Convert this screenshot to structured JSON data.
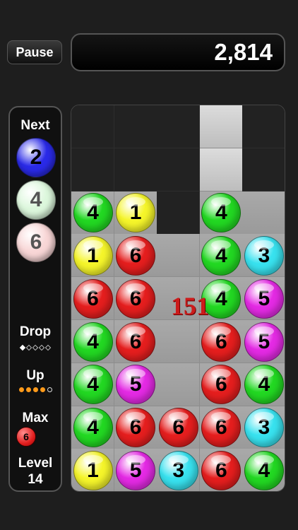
{
  "header": {
    "pause_label": "Pause",
    "score": "2,814"
  },
  "sidebar": {
    "next_label": "Next",
    "next_balls": [
      {
        "value": "2",
        "color": "#2a2ae8",
        "text_color": "#000000"
      },
      {
        "value": "4",
        "color": "#dcf7dc",
        "text_color": "#555555"
      },
      {
        "value": "6",
        "color": "#f8d6d6",
        "text_color": "#555555"
      }
    ],
    "drop_label": "Drop",
    "drop_progress": {
      "filled": 1,
      "total": 5
    },
    "up_label": "Up",
    "up_progress": {
      "filled": 4,
      "total": 5
    },
    "max_label": "Max",
    "max_value": "6",
    "level_label": "Level",
    "level_value": "14"
  },
  "board": {
    "columns": 5,
    "rows": 9,
    "column_heights": [
      7,
      7,
      6,
      9,
      7
    ],
    "cells": [
      [
        null,
        null,
        null,
        null,
        null
      ],
      [
        null,
        null,
        null,
        null,
        null
      ],
      [
        {
          "value": "4",
          "color": "green"
        },
        {
          "value": "1",
          "color": "yellow"
        },
        null,
        {
          "value": "4",
          "color": "green"
        },
        null
      ],
      [
        {
          "value": "1",
          "color": "yellow"
        },
        {
          "value": "6",
          "color": "red"
        },
        null,
        {
          "value": "4",
          "color": "green"
        },
        {
          "value": "3",
          "color": "cyan"
        }
      ],
      [
        {
          "value": "6",
          "color": "red"
        },
        {
          "value": "6",
          "color": "red"
        },
        null,
        {
          "value": "4",
          "color": "green"
        },
        {
          "value": "5",
          "color": "magenta"
        }
      ],
      [
        {
          "value": "4",
          "color": "green"
        },
        {
          "value": "6",
          "color": "red"
        },
        null,
        {
          "value": "6",
          "color": "red"
        },
        {
          "value": "5",
          "color": "magenta"
        }
      ],
      [
        {
          "value": "4",
          "color": "green"
        },
        {
          "value": "5",
          "color": "magenta"
        },
        null,
        {
          "value": "6",
          "color": "red"
        },
        {
          "value": "4",
          "color": "green"
        }
      ],
      [
        {
          "value": "4",
          "color": "green"
        },
        {
          "value": "6",
          "color": "red"
        },
        {
          "value": "6",
          "color": "red"
        },
        {
          "value": "6",
          "color": "red"
        },
        {
          "value": "3",
          "color": "cyan"
        }
      ],
      [
        {
          "value": "1",
          "color": "yellow"
        },
        {
          "value": "5",
          "color": "magenta"
        },
        {
          "value": "3",
          "color": "cyan"
        },
        {
          "value": "6",
          "color": "red"
        },
        {
          "value": "4",
          "color": "green"
        }
      ]
    ],
    "popup_score": "151"
  },
  "colors": {
    "green": "#22d822",
    "yellow": "#f5f52a",
    "red": "#e51e1e",
    "cyan": "#38e2ef",
    "magenta": "#e42ae4",
    "column_light": "#b4b4b4",
    "column_dark": "#222222"
  }
}
